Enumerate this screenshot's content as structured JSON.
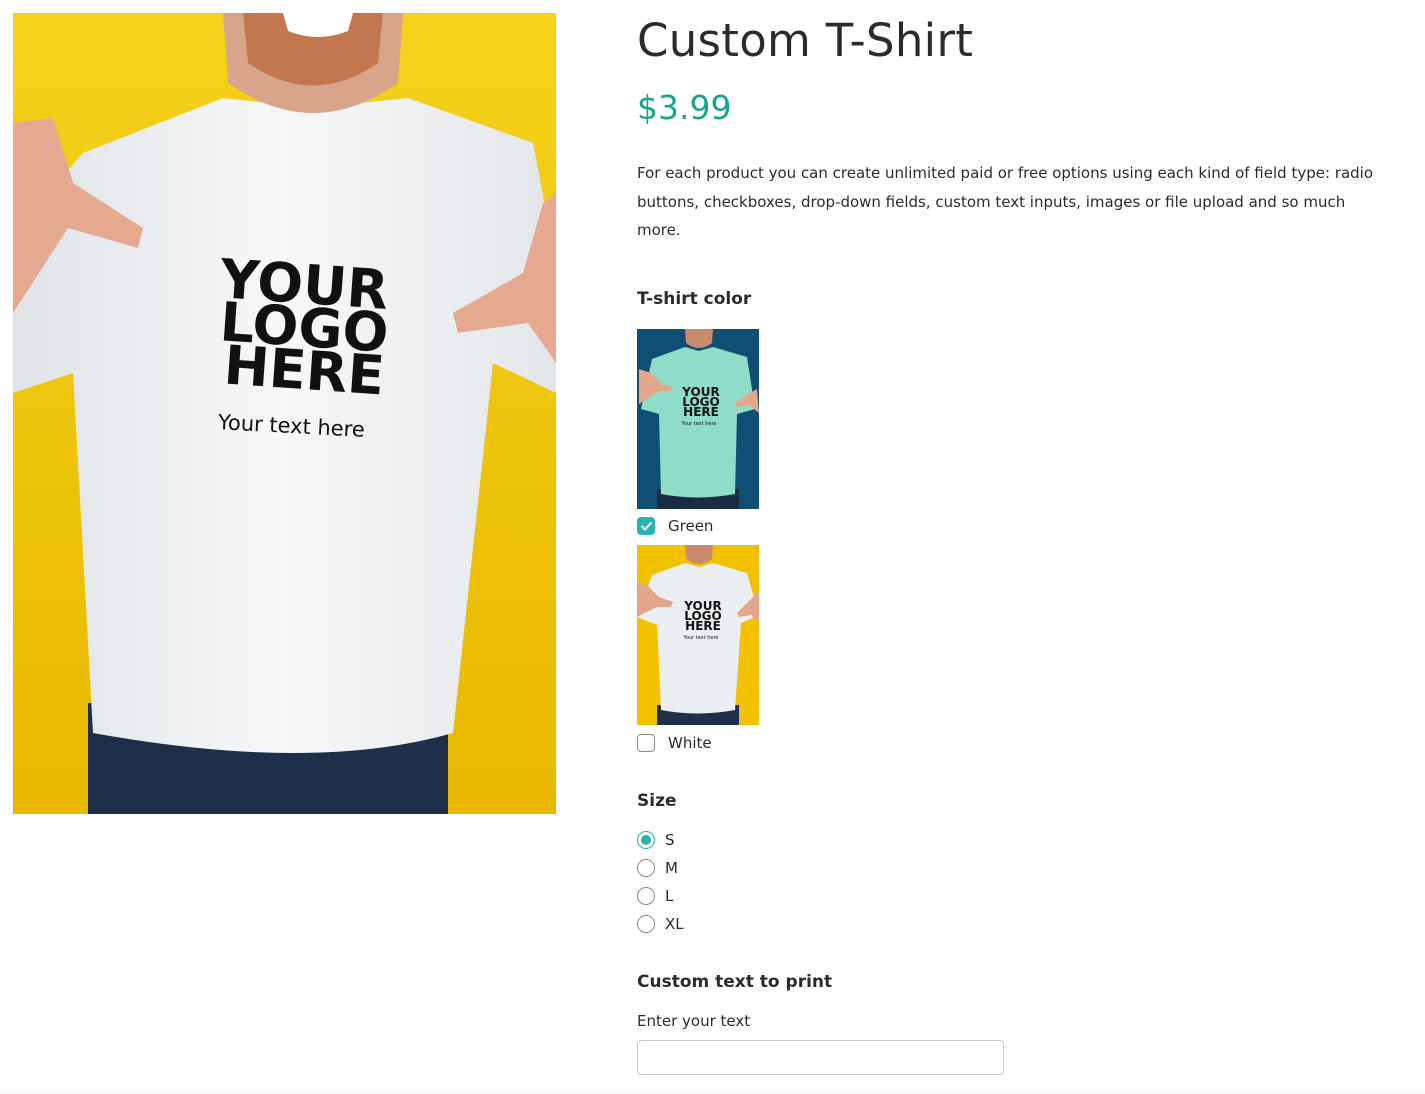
{
  "product": {
    "title": "Custom T-Shirt",
    "price": "$3.99",
    "description": "For each product you can create unlimited paid or free options using each kind of field type: radio buttons, checkboxes, drop-down fields, custom text inputs, images or file upload and so much more.",
    "image": {
      "logo_lines": [
        "YOUR",
        "LOGO",
        "HERE"
      ],
      "shirt_text": "Your text here"
    }
  },
  "color_option": {
    "title": "T-shirt color",
    "choices": [
      {
        "label": "Green",
        "checked": true
      },
      {
        "label": "White",
        "checked": false
      }
    ]
  },
  "size_option": {
    "title": "Size",
    "choices": [
      {
        "label": "S",
        "checked": true
      },
      {
        "label": "M",
        "checked": false
      },
      {
        "label": "L",
        "checked": false
      },
      {
        "label": "XL",
        "checked": false
      }
    ]
  },
  "custom_text_option": {
    "title": "Custom text to print",
    "field_label": "Enter your text",
    "value": "",
    "placeholder": ""
  },
  "colors": {
    "accent": "#2bb3b0",
    "price": "#1aa58a",
    "yellow_background": "#f2c200",
    "blue_background": "#0f4f73",
    "mint_shirt": "#8fdcc8"
  },
  "icons": {
    "checkmark": "checkmark-icon"
  }
}
